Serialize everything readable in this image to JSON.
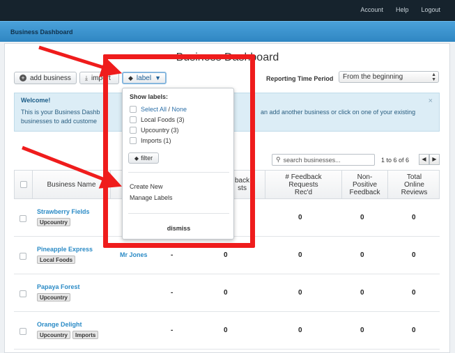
{
  "topbar": {
    "links": [
      "Account",
      "Help",
      "Logout"
    ]
  },
  "titlebar": {
    "title": "Business Dashboard"
  },
  "page": {
    "title": "Business Dashboard"
  },
  "toolbar": {
    "add_label": "add business",
    "import_label": "import",
    "label_label": "label",
    "period_label": "Reporting Time Period",
    "period_value": "From the beginning"
  },
  "welcome": {
    "title": "Welcome!",
    "line1": "This is your Business Dashb",
    "line1b": "an add another business or click on one of your existing",
    "line2": "businesses to add custome"
  },
  "search": {
    "placeholder": "search businesses..."
  },
  "pager": {
    "text": "1 to 6 of 6"
  },
  "table": {
    "headers": {
      "name": "Business Name",
      "col_hidden": "back\nsts",
      "requests": "# Feedback\nRequests\nRec'd",
      "nonpositive": "Non-\nPositive\nFeedback",
      "reviews": "Total\nOnline\nReviews"
    },
    "rows": [
      {
        "name": "Strawberry Fields",
        "tags": [
          "Upcountry"
        ],
        "manager": "",
        "c1": "",
        "c2": "",
        "requests": "0",
        "nonpositive": "0",
        "reviews": "0"
      },
      {
        "name": "Pineapple Express",
        "tags": [
          "Local Foods"
        ],
        "manager": "Mr Jones",
        "c1": "-",
        "c2": "0",
        "requests": "0",
        "nonpositive": "0",
        "reviews": "0"
      },
      {
        "name": "Papaya Forest",
        "tags": [
          "Upcountry"
        ],
        "manager": "",
        "c1": "-",
        "c2": "0",
        "requests": "0",
        "nonpositive": "0",
        "reviews": "0"
      },
      {
        "name": "Orange Delight",
        "tags": [
          "Upcountry",
          "Imports"
        ],
        "manager": "",
        "c1": "-",
        "c2": "0",
        "requests": "0",
        "nonpositive": "0",
        "reviews": "0"
      }
    ]
  },
  "dropdown": {
    "header": "Show labels:",
    "select_all": "Select All",
    "none": "None",
    "options": [
      "Local Foods (3)",
      "Upcountry (3)",
      "Imports (1)"
    ],
    "filter_label": "filter",
    "create_new": "Create New",
    "manage_labels": "Manage Labels",
    "dismiss": "dismiss"
  },
  "colors": {
    "highlight": "#ef1c1c",
    "accent": "#2b8bc6"
  }
}
